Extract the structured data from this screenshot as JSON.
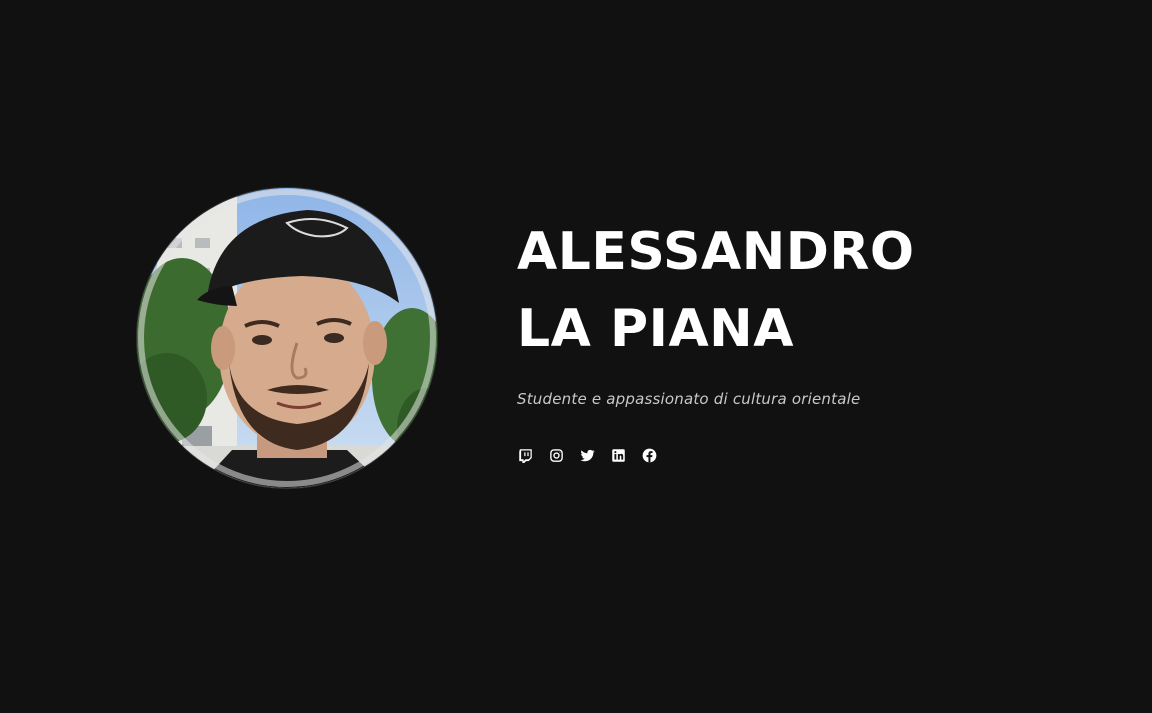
{
  "profile": {
    "name_line1": "ALESSANDRO",
    "name_line2": "LA PIANA",
    "tagline": "Studente e appassionato di cultura orientale"
  },
  "social": [
    {
      "icon": "twitch-icon"
    },
    {
      "icon": "instagram-icon"
    },
    {
      "icon": "twitter-icon"
    },
    {
      "icon": "linkedin-icon"
    },
    {
      "icon": "facebook-icon"
    }
  ],
  "colors": {
    "background": "#111111",
    "text": "#ffffff",
    "tagline": "#c8c8c8"
  }
}
